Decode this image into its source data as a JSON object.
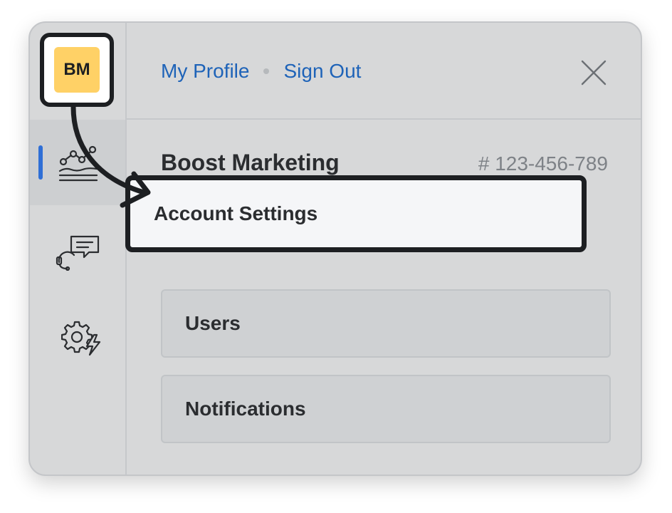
{
  "avatar": {
    "initials": "BM",
    "color": "#ffd166"
  },
  "nav": {
    "my_profile": "My Profile",
    "sign_out": "Sign Out"
  },
  "icons": {
    "close": "close-icon",
    "analytics": "analytics-chart-icon",
    "support": "support-chat-icon",
    "settings": "settings-automation-icon"
  },
  "account": {
    "name": "Boost Marketing",
    "number": "# 123-456-789"
  },
  "menu": {
    "items": [
      {
        "label": "Account Settings"
      },
      {
        "label": "Users"
      },
      {
        "label": "Notifications"
      }
    ]
  },
  "colors": {
    "accent": "#2f6fd6",
    "link": "#1e63b8",
    "panel": "#d7d8d9",
    "highlight": "#1d1f22"
  }
}
